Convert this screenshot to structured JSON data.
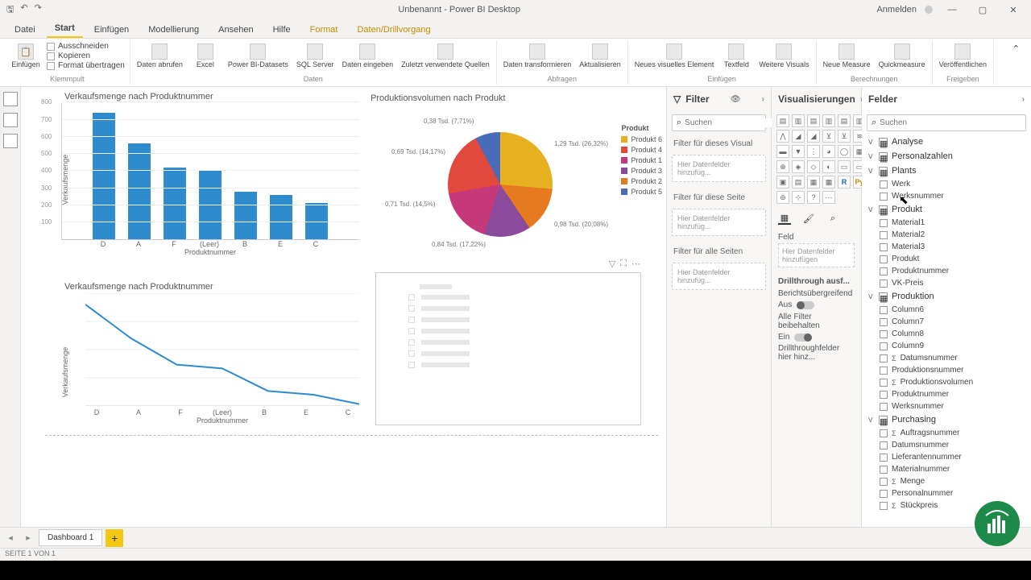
{
  "titlebar": {
    "title": "Unbenannt - Power BI Desktop",
    "signin": "Anmelden"
  },
  "tabs": {
    "file": "Datei",
    "home": "Start",
    "insert": "Einfügen",
    "modeling": "Modellierung",
    "view": "Ansehen",
    "help": "Hilfe",
    "format": "Format",
    "datadrill": "Daten/Drillvorgang"
  },
  "ribbon": {
    "clipboard": {
      "paste": "Einfügen",
      "cut": "Ausschneiden",
      "copy": "Kopieren",
      "formatpainter": "Format übertragen",
      "group": "Klemmpult"
    },
    "data": {
      "getdata": "Daten\nabrufen",
      "excel": "Excel",
      "pbids": "Power\nBI-Datasets",
      "sql": "SQL\nServer",
      "enterdata": "Daten\neingeben",
      "recent": "Zuletzt verwendete\nQuellen",
      "group": "Daten"
    },
    "queries": {
      "transform": "Daten\ntransformieren",
      "refresh": "Aktualisieren",
      "group": "Abfragen"
    },
    "insert": {
      "newvisual": "Neues visuelles\nElement",
      "textbox": "Textfeld",
      "morevisuals": "Weitere\nVisuals",
      "group": "Einfügen"
    },
    "calc": {
      "newmeasure": "Neue\nMeasure",
      "quickmeasure": "Quickmeasure",
      "group": "Berechnungen"
    },
    "share": {
      "publish": "Veröffentlichen",
      "group": "Freigeben"
    }
  },
  "filter": {
    "title": "Filter",
    "search_ph": "Suchen",
    "visual": "Filter für dieses Visual",
    "page": "Filter für diese Seite",
    "all": "Filter für alle Seiten",
    "addhere": "Hier Datenfelder hinzufüg..."
  },
  "vizpane": {
    "title": "Visualisierungen",
    "field_label": "Feld",
    "addfields": "Hier Datenfelder hinzufügen",
    "drill_title": "Drillthrough ausf...",
    "crossreport": "Berichtsübergreifend",
    "off": "Aus",
    "keepall": "Alle Filter beibehalten",
    "on": "Ein",
    "drillfields": "Drillthroughfelder hier hinz..."
  },
  "fields": {
    "title": "Felder",
    "search_ph": "Suchen",
    "tables": [
      {
        "name": "Analyse",
        "fields": []
      },
      {
        "name": "Personalzahlen",
        "fields": []
      },
      {
        "name": "Plants",
        "fields": [
          {
            "name": "Werk"
          },
          {
            "name": "Werksnummer"
          }
        ]
      },
      {
        "name": "Produkt",
        "fields": [
          {
            "name": "Material1"
          },
          {
            "name": "Material2"
          },
          {
            "name": "Material3"
          },
          {
            "name": "Produkt"
          },
          {
            "name": "Produktnummer"
          },
          {
            "name": "VK-Preis"
          }
        ]
      },
      {
        "name": "Produktion",
        "fields": [
          {
            "name": "Column6"
          },
          {
            "name": "Column7"
          },
          {
            "name": "Column8"
          },
          {
            "name": "Column9"
          },
          {
            "name": "Datumsnummer",
            "sigma": true
          },
          {
            "name": "Produktionsnummer"
          },
          {
            "name": "Produktionsvolumen",
            "sigma": true
          },
          {
            "name": "Produktnummer"
          },
          {
            "name": "Werksnummer"
          }
        ]
      },
      {
        "name": "Purchasing",
        "fields": [
          {
            "name": "Auftragsnummer",
            "sigma": true
          },
          {
            "name": "Datumsnummer"
          },
          {
            "name": "Lieferantennummer"
          },
          {
            "name": "Materialnummer"
          },
          {
            "name": "Menge",
            "sigma": true
          },
          {
            "name": "Personalnummer"
          },
          {
            "name": "Stückpreis",
            "sigma": true
          }
        ]
      }
    ]
  },
  "pagetab": {
    "name": "Dashboard 1"
  },
  "status": "SEITE 1 VON 1",
  "chart_data": [
    {
      "type": "bar",
      "title": "Verkaufsmenge nach Produktnummer",
      "xlabel": "Produktnummer",
      "ylabel": "Verkaufsmenge",
      "categories": [
        "D",
        "A",
        "F",
        "(Leer)",
        "B",
        "E",
        "C"
      ],
      "values": [
        740,
        560,
        420,
        400,
        280,
        260,
        210
      ],
      "ylim": [
        0,
        800
      ]
    },
    {
      "type": "pie",
      "title": "Produktionsvolumen nach Produkt",
      "series_label": "Produkt",
      "slices": [
        {
          "name": "Produkt 6",
          "label": "1,29 Tsd. (26,32%)",
          "value": 1290,
          "color": "#e6b020"
        },
        {
          "name": "Produkt 4",
          "label": "0,98 Tsd. (20,08%)",
          "value": 980,
          "color": "#e0493b"
        },
        {
          "name": "Produkt 1",
          "label": "0,84 Tsd. (17,22%)",
          "value": 840,
          "color": "#c5397a"
        },
        {
          "name": "Produkt 3",
          "label": "0,71 Tsd. (14,5%)",
          "value": 710,
          "color": "#8b4a9c"
        },
        {
          "name": "Produkt 2",
          "label": "0,69 Tsd. (14,17%)",
          "value": 690,
          "color": "#e67a20"
        },
        {
          "name": "Produkt 5",
          "label": "0,38 Tsd. (7,71%)",
          "value": 380,
          "color": "#4a6bb8"
        }
      ]
    },
    {
      "type": "line",
      "title": "Verkaufsmenge nach Produktnummer",
      "xlabel": "Produktnummer",
      "ylabel": "Verkaufsmenge",
      "categories": [
        "D",
        "A",
        "F",
        "(Leer)",
        "B",
        "E",
        "C"
      ],
      "values": [
        740,
        560,
        420,
        400,
        280,
        260,
        210
      ],
      "ylim": [
        200,
        800
      ]
    }
  ]
}
